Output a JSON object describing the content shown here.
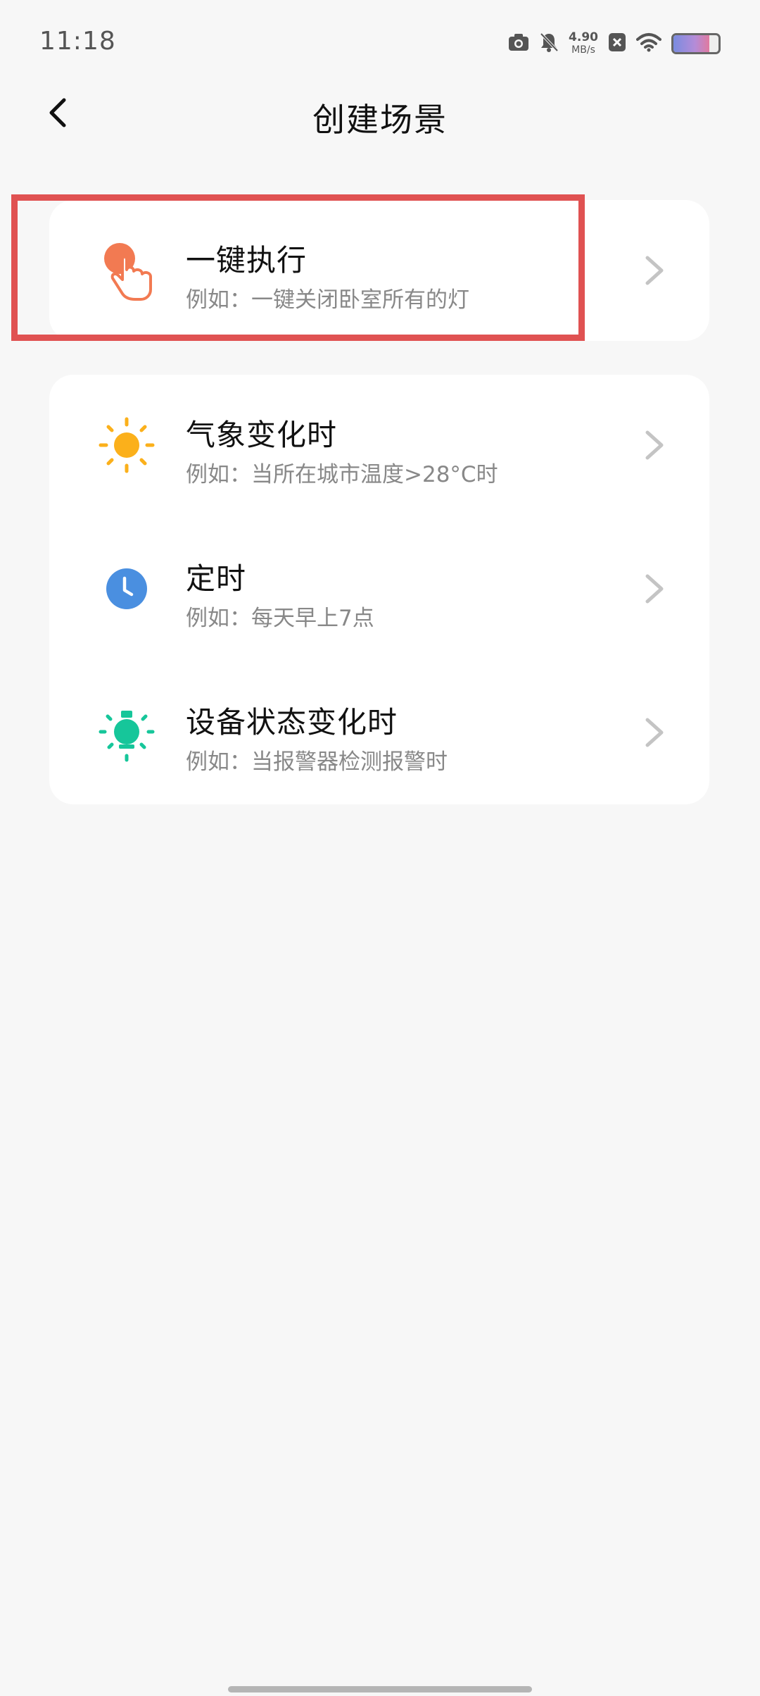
{
  "status_bar": {
    "time": "11:18",
    "network_speed": "4.90",
    "network_unit": "MB/s",
    "icons": [
      "camera-icon",
      "bell-off-icon",
      "close-box-icon",
      "wifi-icon",
      "battery-icon"
    ],
    "battery_level": 0.8
  },
  "header": {
    "title": "创建场景",
    "back_icon": "chevron-left-icon"
  },
  "scenes": [
    {
      "title": "一键执行",
      "subtitle": "例如：一键关闭卧室所有的灯",
      "icon": "tap-hand-icon",
      "icon_color": "#f27a52",
      "highlighted": true
    },
    {
      "title": "气象变化时",
      "subtitle": "例如：当所在城市温度>28°C时",
      "icon": "sun-icon",
      "icon_color": "#fbb01b"
    },
    {
      "title": "定时",
      "subtitle": "例如：每天早上7点",
      "icon": "clock-icon",
      "icon_color": "#4a8fe0"
    },
    {
      "title": "设备状态变化时",
      "subtitle": "例如：当报警器检测报警时",
      "icon": "bulb-icon",
      "icon_color": "#16c69a"
    }
  ],
  "colors": {
    "background": "#f7f7f7",
    "card": "#ffffff",
    "highlight": "#e05252",
    "chevron": "#c4c4c4"
  }
}
